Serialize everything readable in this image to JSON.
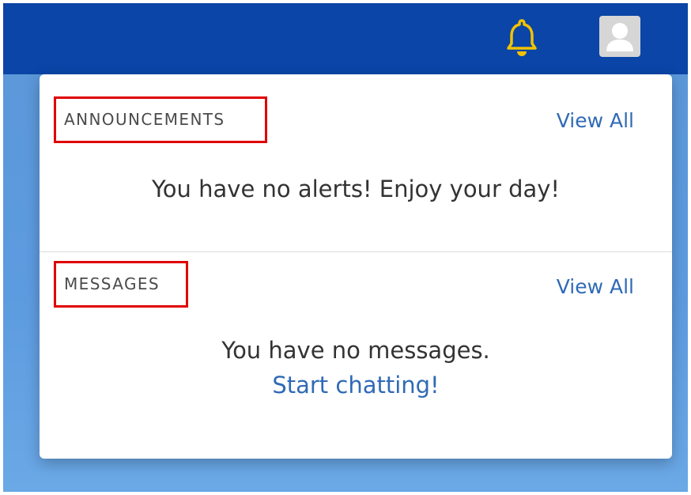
{
  "header": {
    "notifications_icon": "bell-icon",
    "notifications_icon_color": "#f2c200",
    "avatar_icon": "user-avatar-icon",
    "background_color": "#0a45a7"
  },
  "panel": {
    "announcements": {
      "heading": "ANNOUNCEMENTS",
      "view_all": "View All",
      "empty_text": "You have no alerts! Enjoy your day!"
    },
    "messages": {
      "heading": "MESSAGES",
      "view_all": "View All",
      "empty_text": "You have no messages.",
      "start_link": "Start chatting!"
    }
  },
  "colors": {
    "link": "#2f6ab6",
    "highlight_box": "#e00000"
  }
}
